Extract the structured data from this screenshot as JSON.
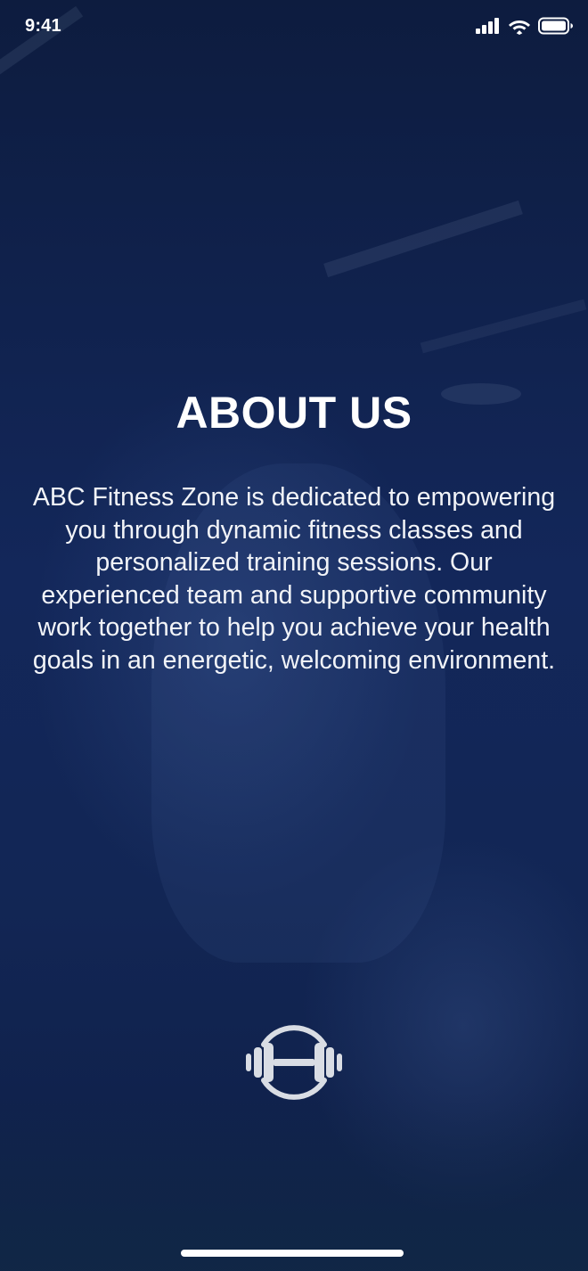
{
  "status_bar": {
    "time": "9:41",
    "icons": [
      "signal-icon",
      "wifi-icon",
      "battery-icon"
    ]
  },
  "about": {
    "title": "ABOUT US",
    "description": "ABC Fitness Zone is dedicated to empowering you through dynamic fitness classes and personalized training sessions. Our experienced team and supportive community work together to help you achieve your health goals in an energetic, welcoming environment."
  },
  "logo": {
    "icon": "dumbbell-logo-icon"
  },
  "colors": {
    "background": "#13275a",
    "text": "#ffffff",
    "logo": "#d9dde4"
  }
}
